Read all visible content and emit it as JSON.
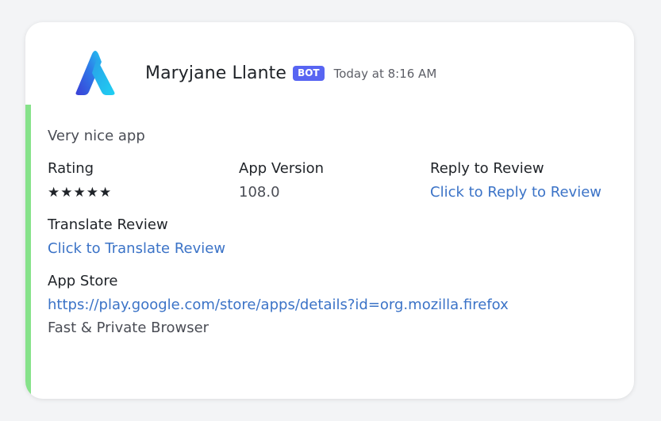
{
  "message": {
    "author": "Maryjane Llante",
    "badge": "BOT",
    "timestamp": "Today at 8:16 AM",
    "accent_color": "#86e28a",
    "avatar_icon": "app-logo-icon"
  },
  "embed": {
    "description": "Very nice app",
    "fields": {
      "rating": {
        "name": "Rating",
        "value": "★★★★★",
        "stars": 5,
        "max_stars": 5
      },
      "app_version": {
        "name": "App Version",
        "value": "108.0"
      },
      "reply": {
        "name": "Reply to Review",
        "link_text": "Click to Reply to Review"
      },
      "translate": {
        "name": "Translate Review",
        "link_text": "Click to Translate Review"
      },
      "app_store": {
        "name": "App Store",
        "url": "https://play.google.com/store/apps/details?id=org.mozilla.firefox",
        "subtitle": "Fast & Private Browser"
      }
    }
  },
  "colors": {
    "link": "#3b73c7",
    "badge_bg": "#5865f2"
  }
}
